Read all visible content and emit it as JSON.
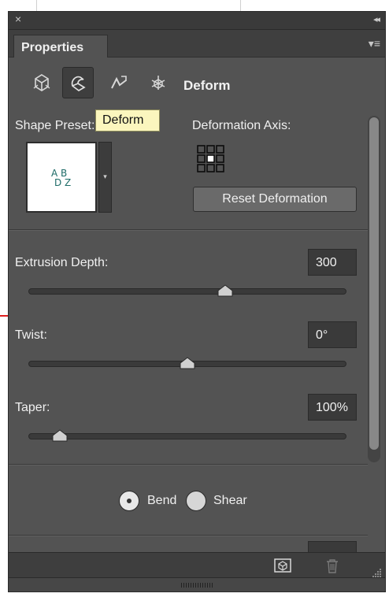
{
  "window": {
    "close_glyph": "×",
    "collapse_glyph": "◂◂"
  },
  "panel": {
    "tab_title": "Properties",
    "menu_glyph": "▾≡"
  },
  "toolbar": {
    "tools": [
      {
        "icon": "mesh-icon"
      },
      {
        "icon": "deform-icon",
        "active": true
      },
      {
        "icon": "cap-icon"
      },
      {
        "icon": "coordinates-icon"
      }
    ],
    "section_label": "Deform",
    "tooltip": "Deform"
  },
  "shape_preset": {
    "label": "Shape Preset:",
    "thumb_line1": "A B",
    "thumb_line2": "D Z",
    "dropdown_glyph": "▾"
  },
  "deformation_axis": {
    "label": "Deformation Axis:"
  },
  "reset_button": "Reset Deformation",
  "params": [
    {
      "label": "Extrusion Depth:",
      "value": "300",
      "level": 0.62
    },
    {
      "label": "Twist:",
      "value": "0°",
      "level": 0.5
    },
    {
      "label": "Taper:",
      "value": "100%",
      "level": 0.1
    }
  ],
  "mode": {
    "options": [
      "Bend",
      "Shear"
    ],
    "selected": "Bend"
  },
  "colors": {
    "panel": "#535353",
    "tooltip": "#fbf6be",
    "guide": "#e02020"
  }
}
